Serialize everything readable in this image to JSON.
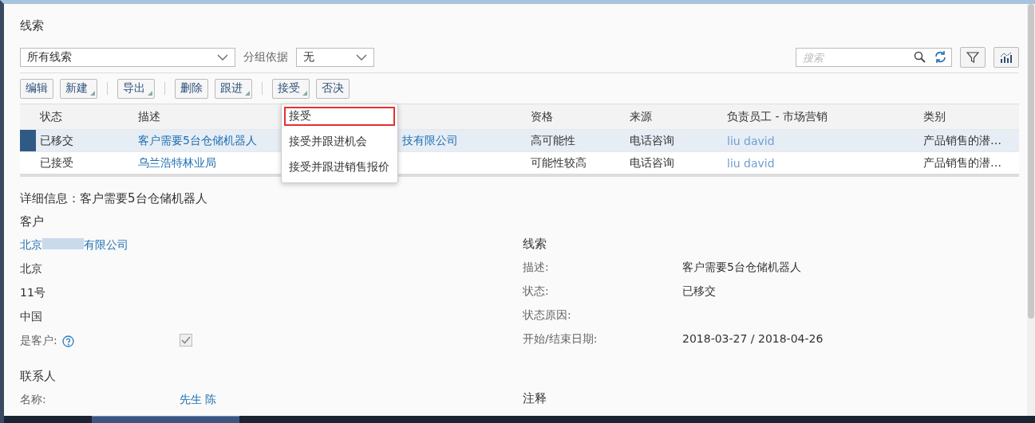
{
  "page_title": "线索",
  "view_select": {
    "value": "所有线索"
  },
  "group_by": {
    "label": "分组依据",
    "value": "无"
  },
  "search": {
    "placeholder": "搜索"
  },
  "toolbar": [
    {
      "label": "编辑",
      "menu": false
    },
    {
      "label": "新建",
      "menu": true
    },
    {
      "kind": "sep"
    },
    {
      "label": "导出",
      "menu": true
    },
    {
      "kind": "sep"
    },
    {
      "label": "删除",
      "menu": false
    },
    {
      "label": "跟进",
      "menu": true
    },
    {
      "kind": "sep"
    },
    {
      "label": "接受",
      "menu": true
    },
    {
      "label": "否决",
      "menu": false
    }
  ],
  "table": {
    "columns": [
      "状态",
      "描述",
      "",
      "资格",
      "来源",
      "负责员工 - 市场营销",
      "类别"
    ],
    "rows": [
      {
        "selected": true,
        "cells": [
          "已移交",
          "客户需要5台仓储机器人",
          "技有限公司",
          "高可能性",
          "电话咨询",
          "liu david",
          "产品销售的潜…"
        ]
      },
      {
        "selected": false,
        "cells": [
          "已接受",
          "乌兰浩特林业局",
          "",
          "可能性较高",
          "电话咨询",
          "liu david",
          "产品销售的潜…"
        ]
      }
    ]
  },
  "accept_menu": [
    {
      "label": "接受",
      "selected": true
    },
    {
      "label": "接受并跟进机会",
      "selected": false
    },
    {
      "label": "接受并跟进销售报价",
      "selected": false
    }
  ],
  "details": {
    "title": "详细信息：客户需要5台仓储机器人",
    "customer": {
      "heading": "客户",
      "name_prefix": "北京",
      "name_suffix": "有限公司",
      "lines": [
        "北京",
        "11号",
        "中国"
      ],
      "is_customer_label": "是客户:",
      "is_customer": true
    },
    "lead": {
      "heading": "线索",
      "fields": [
        {
          "label": "描述:",
          "value": "客户需要5台仓储机器人"
        },
        {
          "label": "状态:",
          "value": "已移交"
        },
        {
          "label": "状态原因:"
        },
        {
          "label": "开始/结束日期:",
          "value": "2018-03-27 / 2018-04-26"
        }
      ]
    },
    "contact": {
      "heading": "联系人",
      "label": "名称:",
      "value": "先生 陈"
    },
    "notes": {
      "heading": "注释"
    }
  }
}
